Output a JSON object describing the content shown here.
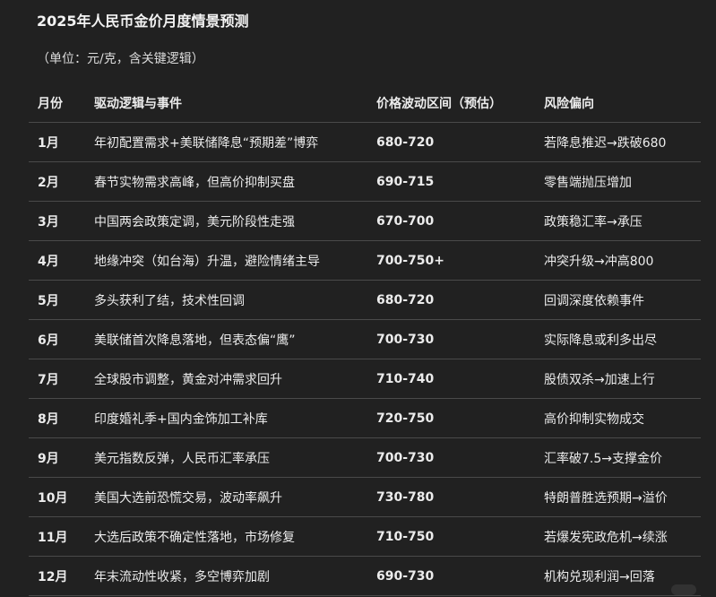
{
  "title": "2025年人民币金价月度情景预测",
  "subtitle": "（单位：元/克，含关键逻辑）",
  "headers": {
    "month": "月份",
    "logic": "驱动逻辑与事件",
    "range": "价格波动区间（预估）",
    "risk": "风险偏向"
  },
  "rows": [
    {
      "month": "1月",
      "logic": "年初配置需求+美联储降息“预期差”博弈",
      "range": "680-720",
      "risk": "若降息推迟→跌破680"
    },
    {
      "month": "2月",
      "logic": "春节实物需求高峰，但高价抑制买盘",
      "range": "690-715",
      "risk": "零售端抛压增加"
    },
    {
      "month": "3月",
      "logic": "中国两会政策定调，美元阶段性走强",
      "range": "670-700",
      "risk": "政策稳汇率→承压"
    },
    {
      "month": "4月",
      "logic": "地缘冲突（如台海）升温，避险情绪主导",
      "range": "700-750+",
      "risk": "冲突升级→冲高800"
    },
    {
      "month": "5月",
      "logic": "多头获利了结，技术性回调",
      "range": "680-720",
      "risk": "回调深度依赖事件"
    },
    {
      "month": "6月",
      "logic": "美联储首次降息落地，但表态偏“鹰”",
      "range": "700-730",
      "risk": "实际降息或利多出尽"
    },
    {
      "month": "7月",
      "logic": "全球股市调整，黄金对冲需求回升",
      "range": "710-740",
      "risk": "股债双杀→加速上行"
    },
    {
      "month": "8月",
      "logic": "印度婚礼季+国内金饰加工补库",
      "range": "720-750",
      "risk": "高价抑制实物成交"
    },
    {
      "month": "9月",
      "logic": "美元指数反弹，人民币汇率承压",
      "range": "700-730",
      "risk": "汇率破7.5→支撑金价"
    },
    {
      "month": "10月",
      "logic": "美国大选前恐慌交易，波动率飙升",
      "range": "730-780",
      "risk": "特朗普胜选预期→溢价"
    },
    {
      "month": "11月",
      "logic": "大选后政策不确定性落地，市场修复",
      "range": "710-750",
      "risk": "若爆发宪政危机→续涨"
    },
    {
      "month": "12月",
      "logic": "年末流动性收紧，多空博弈加剧",
      "range": "690-730",
      "risk": "机构兑现利润→回落"
    }
  ]
}
